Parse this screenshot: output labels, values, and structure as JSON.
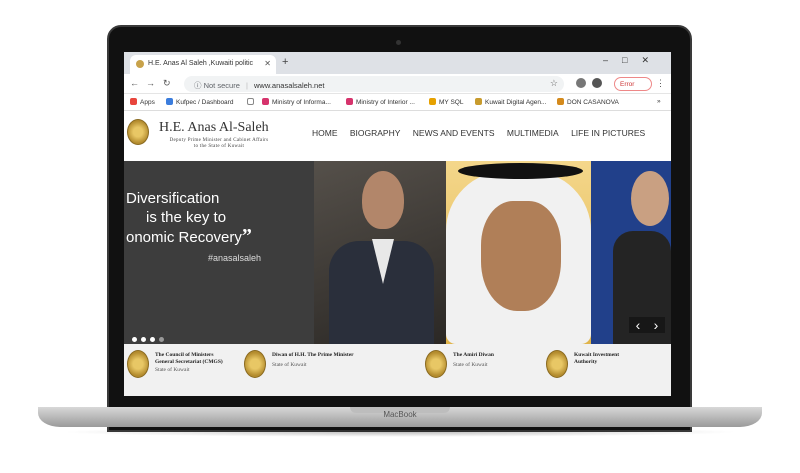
{
  "device": {
    "brand_label": "MacBook"
  },
  "browser": {
    "tab_title": "H.E. Anas Al Saleh ,Kuwaiti politic",
    "tab_close": "✕",
    "new_tab": "+",
    "window_controls": "–□✕",
    "back": "←",
    "forward": "→",
    "reload": "↻",
    "security_label": "Not secure",
    "url": "www.anasalsaleh.net",
    "error_label": "Error",
    "menu": "⋮",
    "bookmarks": [
      "Apps",
      "Kufpec / Dashboard",
      "Ministry of Informa...",
      "Ministry of Interior ...",
      "MY SQL",
      "Kuwait Digital Agen...",
      "DON CASANOVA"
    ],
    "bookmarks_more": "»"
  },
  "site": {
    "title": "H.E. Anas Al-Saleh",
    "subtitle_line1": "Deputy Prime Minister and Cabinet Affairs",
    "subtitle_line2": "to the State of Kuwait",
    "nav": [
      "HOME",
      "BIOGRAPHY",
      "NEWS AND EVENTS",
      "MULTIMEDIA",
      "LIFE IN PICTURES"
    ]
  },
  "hero": {
    "quote_line1": "Diversification",
    "quote_line2": "is the key to",
    "quote_line3": "onomic Recovery",
    "quote_mark": "”",
    "hashtag": "#anasalsaleh",
    "prev_arrow": "‹",
    "next_arrow": "›"
  },
  "partners": [
    {
      "title1": "The Council of Ministers",
      "title2": "General Secretariat (CMGS)",
      "sub": "State of Kuwait"
    },
    {
      "title1": "Diwan of H.H. The Prime Minister",
      "title2": "",
      "sub": "State of Kuwait"
    },
    {
      "title1": "The Amiri Diwan",
      "title2": "",
      "sub": "State of Kuwait"
    },
    {
      "title1": "Kuwait Investment",
      "title2": "Authority",
      "sub": ""
    }
  ]
}
